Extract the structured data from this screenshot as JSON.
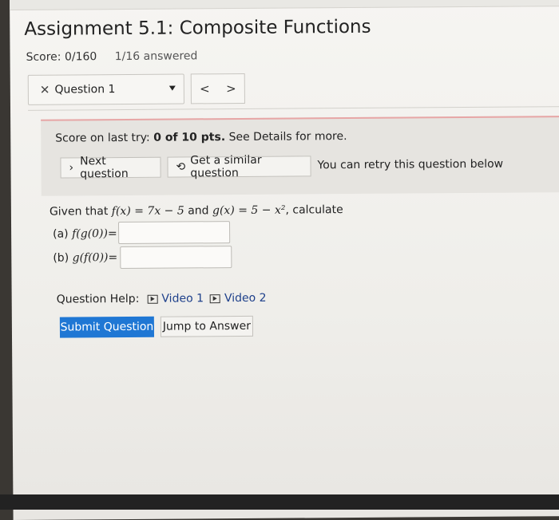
{
  "assignment": {
    "title": "Assignment 5.1: Composite Functions",
    "score": "Score: 0/160",
    "answered": "1/16 answered"
  },
  "question_nav": {
    "status_icon": "x-icon",
    "label": "Question 1",
    "prev_symbol": "<",
    "next_symbol": ">"
  },
  "result": {
    "score_prefix": "Score on last try: ",
    "score_value": "0 of 10 pts.",
    "score_suffix": " See Details for more.",
    "next_label": "Next question",
    "similar_label": "Get a similar question",
    "retry_text": "You can retry this question below"
  },
  "problem": {
    "text_given": "Given that ",
    "f_def": "f(x) = 7x − 5",
    "and_text": " and ",
    "g_def": "g(x) = 5 − x²",
    "calc_text": ", calculate",
    "part_a_label": "(a) ",
    "part_a_expr": "f(g(0))",
    "part_b_label": "(b) ",
    "part_b_expr": "g(f(0))",
    "equals": "=",
    "part_a_value": "",
    "part_b_value": ""
  },
  "help": {
    "label": "Question Help:",
    "video1": "Video 1",
    "video2": "Video 2"
  },
  "actions": {
    "submit_label": "Submit Question",
    "jump_label": "Jump to Answer"
  },
  "colors": {
    "primary_button": "#1f77d4",
    "error_accent": "#e7a6a6"
  }
}
